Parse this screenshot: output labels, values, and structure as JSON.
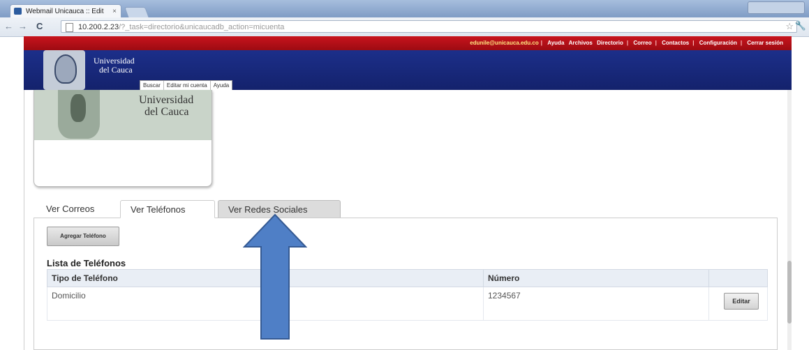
{
  "browser": {
    "tab_title": "Webmail Unicauca :: Edit",
    "tab_close": "×",
    "url_host": "10.200.2.23",
    "url_path": "/?_task=directorio&unicaucadb_action=micuenta",
    "back_glyph": "←",
    "forward_glyph": "→",
    "reload_glyph": "C",
    "star_glyph": "☆",
    "wrench_glyph": "🔧"
  },
  "topbar": {
    "email": "edunile@unicauca.edu.co",
    "links": [
      "Ayuda",
      "Archivos",
      "Directorio",
      "Correo",
      "Contactos",
      "Configuración",
      "Cerrar sesión"
    ]
  },
  "header": {
    "university_line1": "Universidad",
    "university_line2": "del Cauca",
    "menu": [
      "Buscar",
      "Editar mi cuenta",
      "Ayuda"
    ]
  },
  "profile": {
    "university_line1": "Universidad",
    "university_line2": "del Cauca"
  },
  "tabs": [
    "Ver Correos",
    "Ver Teléfonos",
    "Ver Redes Sociales"
  ],
  "active_tab": "Ver Teléfonos",
  "phones": {
    "add_button": "Agregar Teléfono",
    "list_title": "Lista de Teléfonos",
    "columns": [
      "Tipo de Teléfono",
      "Número",
      ""
    ],
    "rows": [
      {
        "type": "Domicilio",
        "number": "1234567",
        "action": "Editar"
      }
    ]
  },
  "colors": {
    "red_bar": "#b4121a",
    "blue_bar": "#182a7c",
    "arrow_fill": "#4f7fc6",
    "arrow_stroke": "#355a93"
  }
}
